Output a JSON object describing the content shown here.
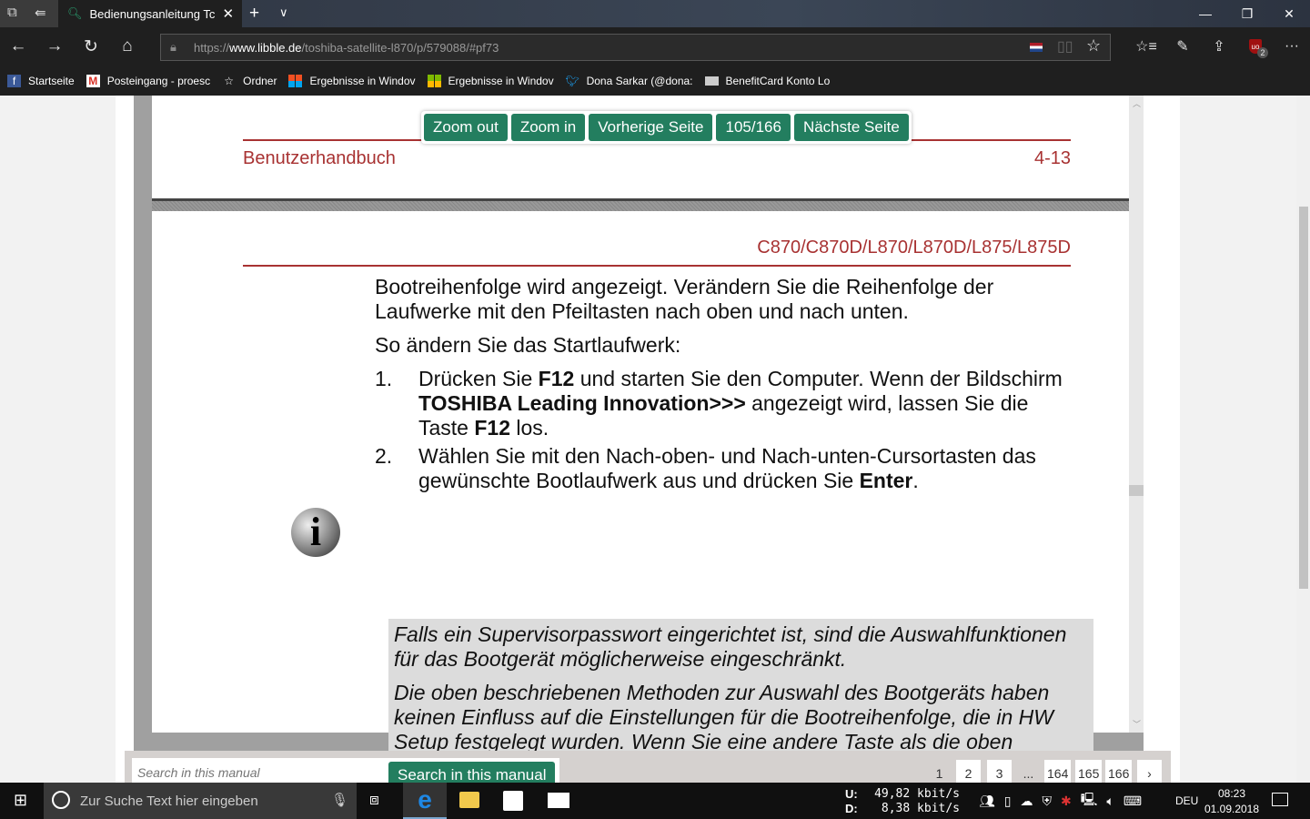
{
  "browser": {
    "tab_title": "Bedienungsanleitung Tc",
    "url_prefix": "https://",
    "url_domain": "www.libble.de",
    "url_path": "/toshiba-satellite-l870/p/579088/#pf73",
    "extension_badge": "2",
    "bookmarks": [
      {
        "label": "Startseite",
        "icon": "facebook-icon",
        "color": "#3b5998"
      },
      {
        "label": "Posteingang - proesc",
        "icon": "gmail-icon",
        "color": "#d93025"
      },
      {
        "label": "Ordner",
        "icon": "star-icon",
        "color": "#ffffff"
      },
      {
        "label": "Ergebnisse in Windov",
        "icon": "windows-logo-icon",
        "color": "#f25022"
      },
      {
        "label": "Ergebnisse in Windov",
        "icon": "windows-logo-icon",
        "color": "#f25022"
      },
      {
        "label": "Dona Sarkar (@dona:",
        "icon": "twitter-icon",
        "color": "#1da1f2"
      },
      {
        "label": "BenefitCard Konto Lo",
        "icon": "card-icon",
        "color": "#cccccc"
      }
    ]
  },
  "viewer": {
    "toolbar": {
      "zoom_out": "Zoom out",
      "zoom_in": "Zoom in",
      "prev": "Vorherige Seite",
      "page_indicator": "105/166",
      "next": "Nächste Seite"
    },
    "page1": {
      "header_left": "Benutzerhandbuch",
      "header_right": "4-13"
    },
    "page2": {
      "model": "C870/C870D/L870/L870D/L875/L875D",
      "para1": "Bootreihenfolge wird angezeigt. Verändern Sie die Reihenfolge der Laufwerke mit den Pfeiltasten nach oben und nach unten.",
      "para2": "So ändern Sie das Startlaufwerk:",
      "steps": [
        {
          "num": "1.",
          "t1": "Drücken Sie ",
          "b1": "F12",
          "t2": " und starten Sie den Computer. Wenn der Bildschirm ",
          "b2": "TOSHIBA Leading Innovation>>>",
          "t3": " angezeigt wird, lassen Sie die Taste ",
          "b3": "F12",
          "t4": " los."
        },
        {
          "num": "2.",
          "t1": "Wählen Sie mit den Nach-oben- und Nach-unten-Cursortasten das gewünschte Bootlaufwerk aus und drücken Sie ",
          "b1": "Enter",
          "t2": "."
        }
      ],
      "note1": "Falls ein Supervisorpasswort eingerichtet ist, sind die Auswahlfunktionen für das Bootgerät möglicherweise eingeschränkt.",
      "note2": "Die oben beschriebenen Methoden zur Auswahl des Bootgeräts haben keinen Einfluss auf die Einstellungen für die Bootreihenfolge, die in HW Setup festgelegt wurden. Wenn Sie eine andere Taste als die oben aufgeführten drücken oder wenn das gewählte Gerät nicht installiert ist, verwendet das System das im HW Setup spezifizierte Laufwerk zum Booten (nach Verfügbarkeit)."
    },
    "search": {
      "placeholder": "Search in this manual",
      "button": "Search in this manual"
    },
    "pagination": [
      "1",
      "2",
      "3",
      "...",
      "164",
      "165",
      "166",
      "›"
    ],
    "accent": "#237e5f",
    "header_color": "#a83232"
  },
  "taskbar": {
    "search_placeholder": "Zur Suche Text hier eingeben",
    "net_up_label": "U:",
    "net_up": "49,82 kbit/s",
    "net_down_label": "D:",
    "net_down": "8,38 kbit/s",
    "language": "DEU",
    "time": "08:23",
    "date": "01.09.2018"
  }
}
